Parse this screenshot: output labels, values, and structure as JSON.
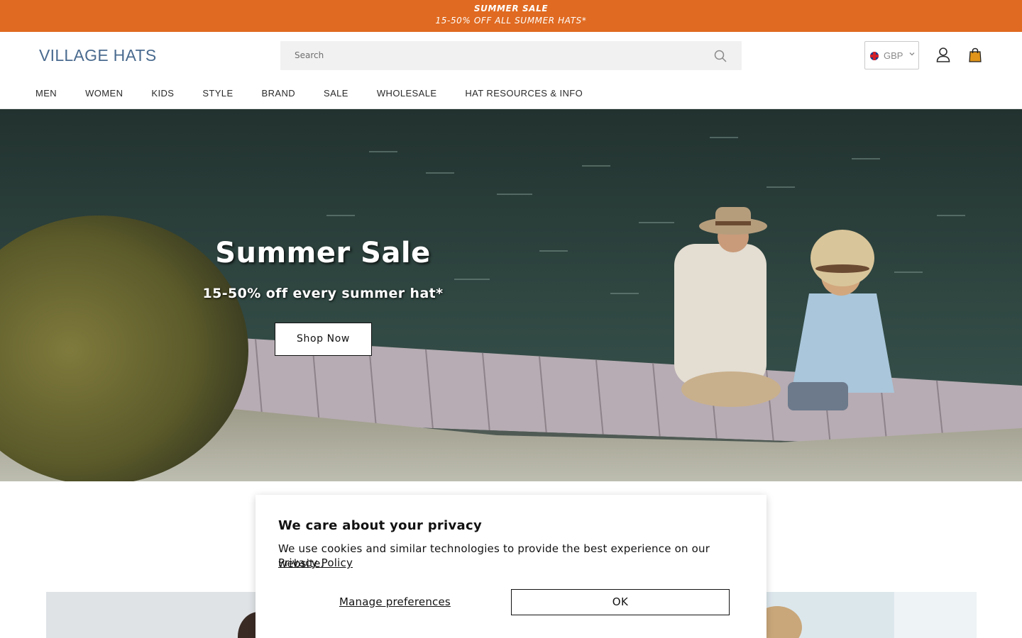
{
  "announcement": {
    "title": "SUMMER SALE",
    "subtitle": "15-50% OFF ALL SUMMER HATS*"
  },
  "header": {
    "logo": "VILLAGE HATS",
    "search_placeholder": "Search",
    "currency": "GBP",
    "icons": [
      "search-icon",
      "flag-icon",
      "chevron-down-icon",
      "account-icon",
      "cart-icon"
    ]
  },
  "nav": {
    "items": [
      "MEN",
      "WOMEN",
      "KIDS",
      "STYLE",
      "BRAND",
      "SALE",
      "WHOLESALE",
      "HAT RESOURCES & INFO"
    ]
  },
  "hero": {
    "title": "Summer Sale",
    "subtitle": "15-50% off every summer hat*",
    "button": "Shop Now"
  },
  "cookie": {
    "heading": "We care about your privacy",
    "body": "We use cookies and similar technologies to provide the best experience on our website.",
    "policy_link": "Privacy Policy",
    "manage": "Manage preferences",
    "ok": "OK"
  },
  "colors": {
    "announcement_bg": "#e06a21",
    "logo": "#4a6b8f",
    "cart": "#e0951a"
  }
}
